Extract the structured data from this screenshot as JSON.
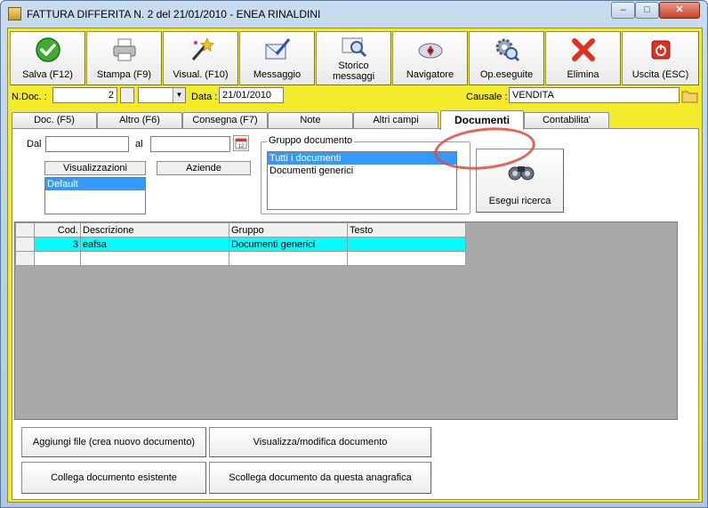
{
  "window": {
    "title": "FATTURA DIFFERITA N. 2  del 21/01/2010 - ENEA RINALDINI",
    "minimize_glyph": "–",
    "maximize_glyph": "□",
    "close_glyph": "✕"
  },
  "toolbar": {
    "buttons": [
      {
        "label": "Salva (F12)",
        "icon": "check-icon"
      },
      {
        "label": "Stampa (F9)",
        "icon": "printer-icon"
      },
      {
        "label": "Visual. (F10)",
        "icon": "magic-wand-icon"
      },
      {
        "label": "Messaggio",
        "icon": "envelope-pen-icon"
      },
      {
        "label": "Storico messaggi",
        "icon": "message-history-icon"
      },
      {
        "label": "Navigatore",
        "icon": "compass-icon"
      },
      {
        "label": "Op.eseguite",
        "icon": "gear-search-icon"
      },
      {
        "label": "Elimina",
        "icon": "delete-x-icon"
      },
      {
        "label": "Uscita (ESC)",
        "icon": "power-icon"
      }
    ]
  },
  "header_fields": {
    "ndoc_label": "N.Doc. :",
    "ndoc_value": "2",
    "data_label": "Data :",
    "data_value": "21/01/2010",
    "causale_label": "Causale :",
    "causale_value": "VENDITA"
  },
  "tabs": [
    {
      "label": "Doc. (F5)"
    },
    {
      "label": "Altro (F6)"
    },
    {
      "label": "Consegna (F7)"
    },
    {
      "label": "Note"
    },
    {
      "label": "Altri campi"
    },
    {
      "label": "Documenti",
      "active": true
    },
    {
      "label": "Contabilita'"
    }
  ],
  "filters": {
    "dal_label": "Dal",
    "al_label": "al",
    "dal_value": "",
    "al_value": "",
    "visualizzazioni_label": "Visualizzazioni",
    "aziende_label": "Aziende",
    "visualizzazioni_items": [
      "Default"
    ],
    "gruppo_title": "Gruppo documento",
    "gruppo_items": [
      "Tutti i documenti",
      "Documenti generici"
    ],
    "search_button": "Esegui ricerca"
  },
  "grid": {
    "columns": [
      "Cod.",
      "Descrizione",
      "Gruppo",
      "Testo"
    ],
    "rows": [
      {
        "cod": "3",
        "descrizione": "eafsa",
        "gruppo": "Documenti generici",
        "testo": ""
      }
    ]
  },
  "actions": {
    "add_file": "Aggiungi file (crea nuovo documento)",
    "view_edit": "Visualizza/modifica documento",
    "link_existing": "Collega documento esistente",
    "unlink": "Scollega documento da questa anagrafica"
  }
}
